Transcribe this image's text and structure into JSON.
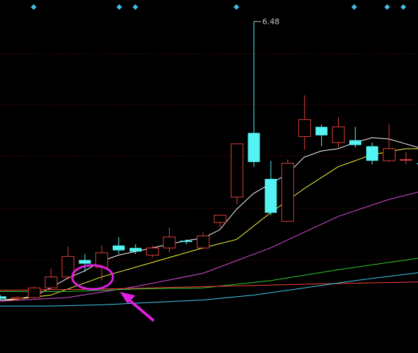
{
  "chart_data": {
    "type": "candlestick",
    "annotations": {
      "high_label": "6.48",
      "marker_count": 7,
      "highlight": {
        "shape": "ellipse",
        "color": "#e020e0",
        "pointer": "arrow"
      }
    },
    "colors": {
      "background": "#000000",
      "grid": "#7a1010",
      "up_candle": "#e0403a",
      "down_candle": "#54f4f4",
      "diamond_marker": "#3fc3e0",
      "ma1": "#ffffff",
      "ma2": "#ffff40",
      "ma3": "#e050e0",
      "ma4": "#30d030",
      "ma5": "#ff4040",
      "ma6": "#40d0f0",
      "highlight": "#e020e0"
    },
    "y_range": [
      3.8,
      6.6
    ],
    "candles": [
      {
        "open": 4.21,
        "close": 4.19,
        "high": 4.22,
        "low": 4.18
      },
      {
        "open": 4.19,
        "close": 4.2,
        "high": 4.21,
        "low": 4.17
      },
      {
        "open": 4.2,
        "close": 4.28,
        "high": 4.29,
        "low": 4.19
      },
      {
        "open": 4.28,
        "close": 4.37,
        "high": 4.44,
        "low": 4.27
      },
      {
        "open": 4.37,
        "close": 4.54,
        "high": 4.62,
        "low": 4.35
      },
      {
        "open": 4.51,
        "close": 4.48,
        "high": 4.56,
        "low": 4.41
      },
      {
        "open": 4.45,
        "close": 4.57,
        "high": 4.63,
        "low": 4.34
      },
      {
        "open": 4.63,
        "close": 4.59,
        "high": 4.7,
        "low": 4.56
      },
      {
        "open": 4.61,
        "close": 4.58,
        "high": 4.64,
        "low": 4.56
      },
      {
        "open": 4.55,
        "close": 4.61,
        "high": 4.63,
        "low": 4.53
      },
      {
        "open": 4.61,
        "close": 4.7,
        "high": 4.78,
        "low": 4.57
      },
      {
        "open": 4.67,
        "close": 4.66,
        "high": 4.68,
        "low": 4.64
      },
      {
        "open": 4.61,
        "close": 4.71,
        "high": 4.74,
        "low": 4.6
      },
      {
        "open": 4.82,
        "close": 4.88,
        "high": 4.88,
        "low": 4.78
      },
      {
        "open": 5.03,
        "close": 5.47,
        "high": 5.47,
        "low": 4.97
      },
      {
        "open": 5.56,
        "close": 5.32,
        "high": 6.48,
        "low": 5.28
      },
      {
        "open": 5.18,
        "close": 4.9,
        "high": 5.33,
        "low": 4.88
      },
      {
        "open": 4.83,
        "close": 5.31,
        "high": 5.34,
        "low": 4.83
      },
      {
        "open": 5.53,
        "close": 5.67,
        "high": 5.87,
        "low": 5.42
      },
      {
        "open": 5.61,
        "close": 5.54,
        "high": 5.63,
        "low": 5.45
      },
      {
        "open": 5.48,
        "close": 5.61,
        "high": 5.69,
        "low": 5.44
      },
      {
        "open": 5.5,
        "close": 5.46,
        "high": 5.61,
        "low": 5.44
      },
      {
        "open": 5.45,
        "close": 5.33,
        "high": 5.48,
        "low": 5.3
      },
      {
        "open": 5.33,
        "close": 5.43,
        "high": 5.63,
        "low": 5.32
      },
      {
        "open": 5.34,
        "close": 5.34,
        "high": 5.4,
        "low": 5.3
      },
      {
        "open": 5.31,
        "close": 5.3,
        "high": 5.36,
        "low": 5.27
      }
    ],
    "moving_averages": [
      {
        "key": "ma1",
        "x": [
          0,
          1,
          2,
          3,
          4,
          5,
          6,
          7,
          8,
          9,
          10,
          11,
          12,
          13,
          14,
          15,
          16,
          17,
          18,
          19,
          20,
          21,
          22,
          23,
          24,
          25
        ],
        "y": [
          4.18,
          4.19,
          4.21,
          4.28,
          4.36,
          4.42,
          4.5,
          4.55,
          4.58,
          4.61,
          4.64,
          4.67,
          4.69,
          4.76,
          4.93,
          5.06,
          5.14,
          5.22,
          5.36,
          5.41,
          5.43,
          5.48,
          5.52,
          5.51,
          5.47,
          5.43
        ]
      },
      {
        "key": "ma2",
        "x": [
          0,
          3,
          6,
          9,
          12,
          14,
          16,
          18,
          20,
          22,
          24,
          25
        ],
        "y": [
          4.17,
          4.22,
          4.37,
          4.49,
          4.61,
          4.68,
          4.9,
          5.1,
          5.28,
          5.38,
          5.43,
          5.43
        ]
      },
      {
        "key": "ma3",
        "x": [
          0,
          4,
          8,
          12,
          16,
          20,
          23,
          25
        ],
        "y": [
          4.17,
          4.2,
          4.29,
          4.4,
          4.61,
          4.87,
          5.01,
          5.08
        ]
      },
      {
        "key": "ma4",
        "x": [
          0,
          4,
          8,
          12,
          16,
          20,
          24,
          25
        ],
        "y": [
          4.25,
          4.25,
          4.27,
          4.28,
          4.34,
          4.43,
          4.51,
          4.53
        ]
      },
      {
        "key": "ma5",
        "x": [
          0,
          6,
          12,
          18,
          25
        ],
        "y": [
          4.26,
          4.27,
          4.29,
          4.31,
          4.33
        ]
      },
      {
        "key": "ma6",
        "x": [
          0,
          3,
          6,
          9,
          12,
          15,
          18,
          21,
          25
        ],
        "y": [
          4.13,
          4.13,
          4.14,
          4.16,
          4.18,
          4.22,
          4.28,
          4.34,
          4.41
        ]
      }
    ]
  }
}
